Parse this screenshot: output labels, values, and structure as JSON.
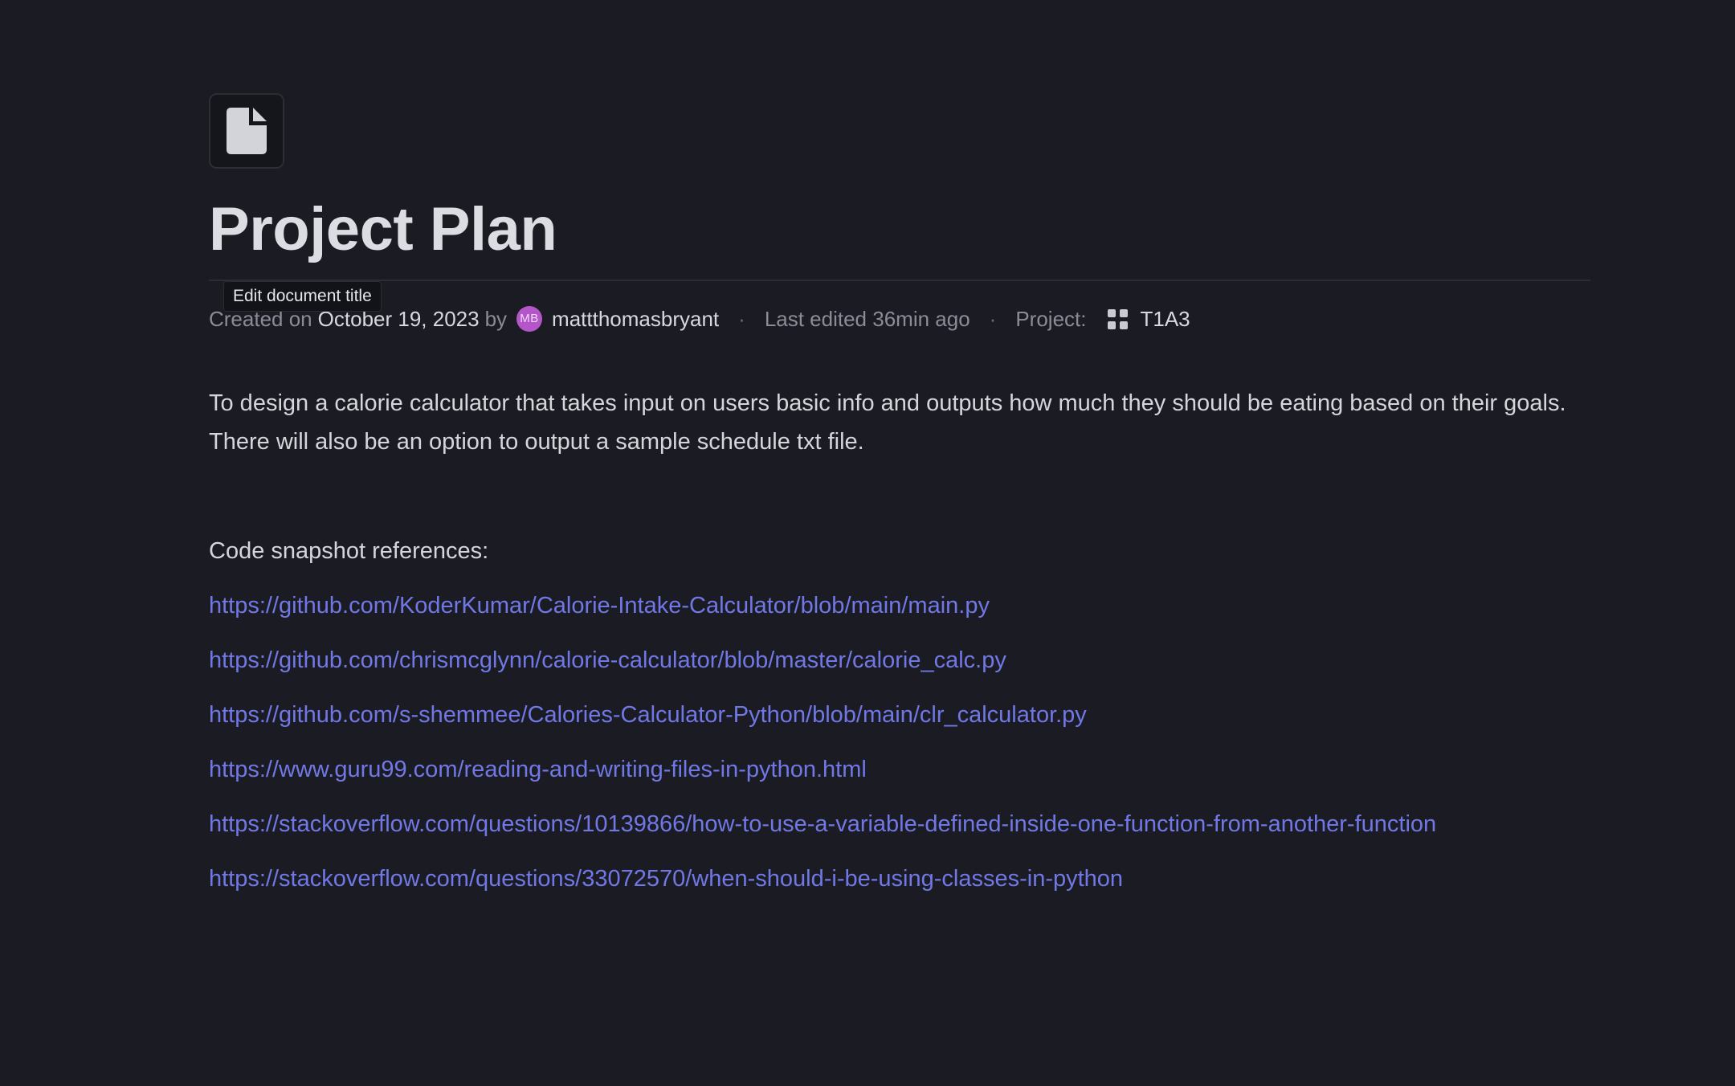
{
  "document": {
    "icon": "document-icon",
    "title": "Project Plan",
    "tooltip": "Edit document title"
  },
  "meta": {
    "created_prefix": "Created on",
    "created_date": "October 19, 2023",
    "by": "by",
    "avatar_initials": "MB",
    "author": "mattthomasbryant",
    "separator": "·",
    "last_edited": "Last edited 36min ago",
    "project_label": "Project:",
    "project_icon": "grid-icon",
    "project_name": "T1A3"
  },
  "content": {
    "description": "To design a calorie calculator that takes input on users basic info and outputs how much they should be eating based on their goals. There will also be an option to output a sample schedule txt file.",
    "references_heading": "Code snapshot references:",
    "links": [
      "https://github.com/KoderKumar/Calorie-Intake-Calculator/blob/main/main.py",
      "https://github.com/chrismcglynn/calorie-calculator/blob/master/calorie_calc.py",
      "https://github.com/s-shemmee/Calories-Calculator-Python/blob/main/clr_calculator.py",
      "https://www.guru99.com/reading-and-writing-files-in-python.html",
      "https://stackoverflow.com/questions/10139866/how-to-use-a-variable-defined-inside-one-function-from-another-function",
      "https://stackoverflow.com/questions/33072570/when-should-i-be-using-classes-in-python"
    ]
  },
  "colors": {
    "background": "#1b1c23",
    "link": "#7178e6",
    "avatar": "#b455c9"
  }
}
